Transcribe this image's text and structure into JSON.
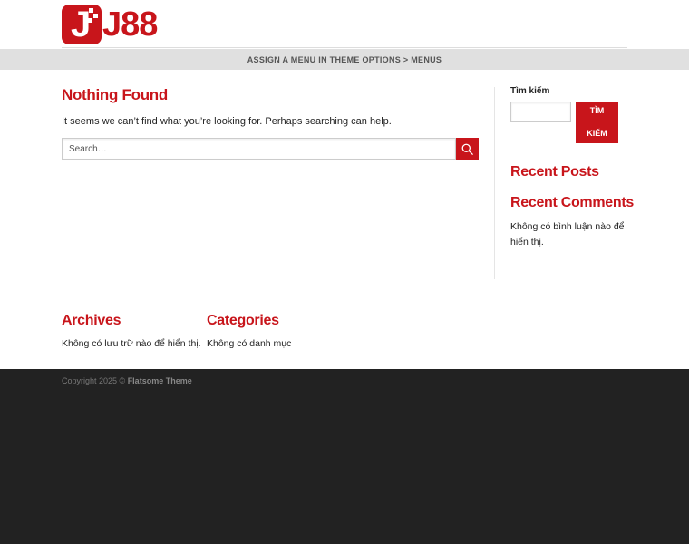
{
  "header": {
    "logo_text": "J88",
    "logo_badge_letter": "J"
  },
  "navbar": {
    "menu_notice": "ASSIGN A MENU IN THEME OPTIONS > MENUS"
  },
  "main": {
    "title": "Nothing Found",
    "message": "It seems we can’t find what you’re looking for. Perhaps searching can help.",
    "search_placeholder": "Search…"
  },
  "sidebar": {
    "search_label": "Tìm kiếm",
    "search_button": "TÌM KIẾM",
    "recent_posts_title": "Recent Posts",
    "recent_comments_title": "Recent Comments",
    "no_comments_text": "Không có bình luận nào để hiển thị."
  },
  "footer": {
    "archives_title": "Archives",
    "archives_text": "Không có lưu trữ nào để hiển thị.",
    "categories_title": "Categories",
    "categories_text": "Không có danh mục",
    "copyright_prefix": "Copyright 2025 ©",
    "copyright_theme": "Flatsome Theme"
  },
  "colors": {
    "accent": "#c8151b",
    "bottom_bar": "#222222",
    "nav_bar": "#e0e0e0"
  },
  "icons": {
    "search_button_icon": "search-icon"
  }
}
